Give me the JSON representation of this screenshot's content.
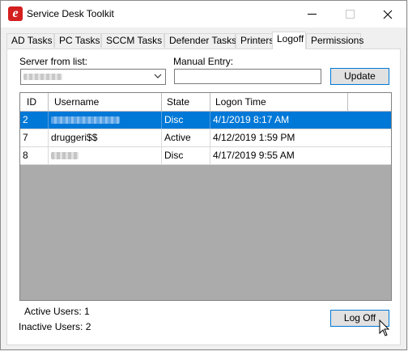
{
  "window": {
    "title": "Service Desk Toolkit",
    "icon_letter": "e"
  },
  "tabs": [
    {
      "label": "AD Tasks"
    },
    {
      "label": "PC Tasks"
    },
    {
      "label": "SCCM Tasks"
    },
    {
      "label": "Defender Tasks"
    },
    {
      "label": "Printers"
    },
    {
      "label": "Logoff",
      "active": true
    },
    {
      "label": "Permissions"
    }
  ],
  "form": {
    "server_label": "Server from list:",
    "manual_label": "Manual Entry:",
    "manual_value": "",
    "update_label": "Update"
  },
  "grid": {
    "columns": [
      "ID",
      "Username",
      "State",
      "Logon Time"
    ],
    "rows": [
      {
        "id": "2",
        "username": "",
        "username_redacted": true,
        "state": "Disc",
        "logon_time": "4/1/2019 8:17 AM",
        "selected": true
      },
      {
        "id": "7",
        "username": "druggeri$$",
        "username_redacted": false,
        "state": "Active",
        "logon_time": "4/12/2019 1:59 PM",
        "selected": false
      },
      {
        "id": "8",
        "username": "",
        "username_redacted": true,
        "state": "Disc",
        "logon_time": "4/17/2019 9:55 AM",
        "selected": false
      }
    ]
  },
  "status": {
    "active_users": "Active Users: 1",
    "inactive_users": "Inactive Users: 2"
  },
  "logoff_label": "Log Off",
  "colors": {
    "selection": "#0078d7",
    "grid_background": "#ababab",
    "button_border": "#0078d7",
    "app_icon": "#d41f1f"
  }
}
